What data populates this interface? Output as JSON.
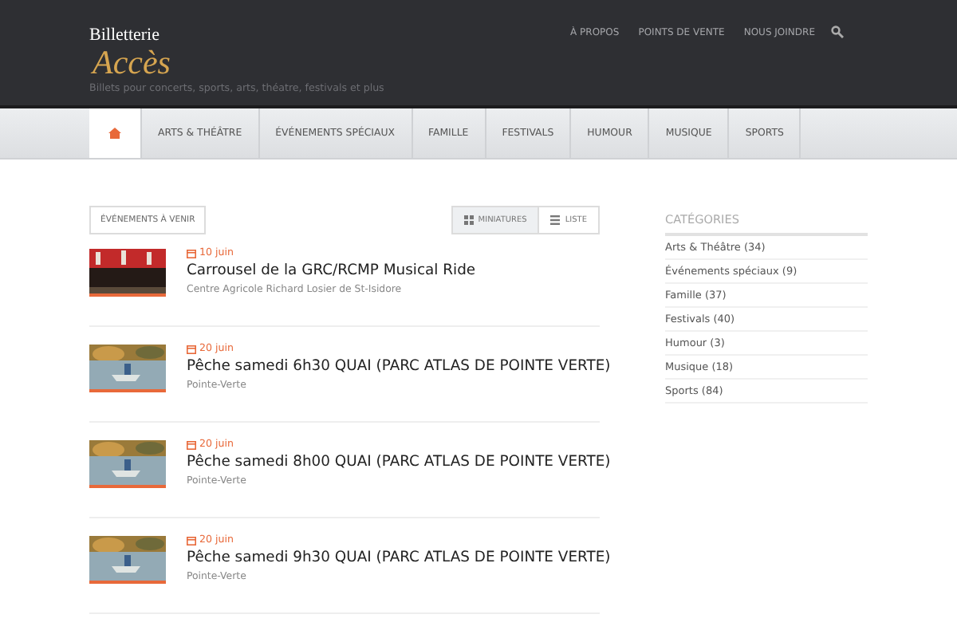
{
  "logo": {
    "line1": "Billetterie",
    "line2": "Accès"
  },
  "tagline": "Billets pour concerts, sports, arts, théatre, festivals et plus",
  "top_links": [
    "À PROPOS",
    "POINTS DE VENTE",
    "NOUS JOINDRE"
  ],
  "nav": [
    {
      "kind": "home",
      "selected": true
    },
    {
      "label": "ARTS & THÉÂTRE",
      "selected": false
    },
    {
      "label": "ÉVÉNEMENTS SPÉCIAUX",
      "selected": false
    },
    {
      "label": "FAMILLE",
      "selected": false
    },
    {
      "label": "FESTIVALS",
      "selected": false
    },
    {
      "label": "HUMOUR",
      "selected": false
    },
    {
      "label": "MUSIQUE",
      "selected": false
    },
    {
      "label": "SPORTS",
      "selected": false
    }
  ],
  "filter_button": "ÉVÉNEMENTS À VENIR",
  "view_toggle": [
    {
      "label": "MINIATURES",
      "kind": "grid",
      "selected": true
    },
    {
      "label": "LISTE",
      "kind": "list",
      "selected": false
    }
  ],
  "events": [
    {
      "date": "10 juin",
      "title": "Carrousel de la GRC/RCMP Musical Ride",
      "venue": "Centre Agricole Richard Losier de St-Isidore"
    },
    {
      "date": "20 juin",
      "title": "Pêche samedi 6h30 QUAI (PARC ATLAS DE POINTE VERTE)",
      "venue": "Pointe-Verte"
    },
    {
      "date": "20 juin",
      "title": "Pêche samedi 8h00 QUAI (PARC ATLAS DE POINTE VERTE)",
      "venue": "Pointe-Verte"
    },
    {
      "date": "20 juin",
      "title": "Pêche samedi 9h30 QUAI (PARC ATLAS DE POINTE VERTE)",
      "venue": "Pointe-Verte"
    }
  ],
  "sidebar": {
    "title": "CATÉGORIES",
    "items": [
      "Arts & Théâtre (34)",
      "Événements spéciaux (9)",
      "Famille (37)",
      "Festivals (40)",
      "Humour (3)",
      "Musique (18)",
      "Sports (84)"
    ]
  }
}
